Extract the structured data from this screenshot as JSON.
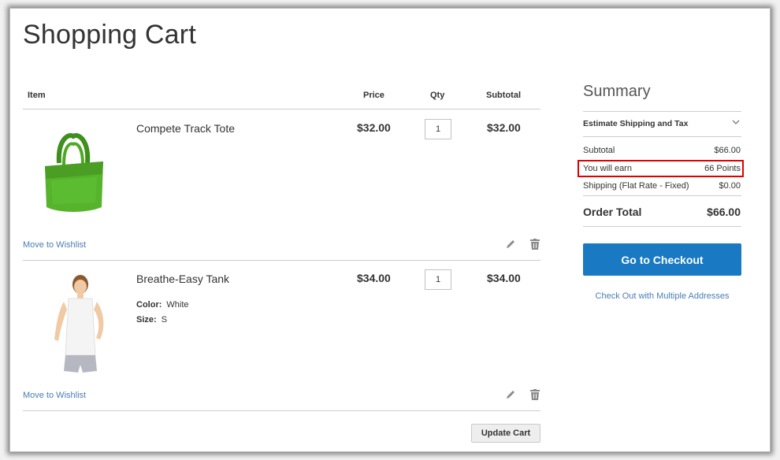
{
  "page": {
    "title": "Shopping Cart"
  },
  "cart": {
    "headers": {
      "item": "Item",
      "price": "Price",
      "qty": "Qty",
      "subtotal": "Subtotal"
    },
    "items": [
      {
        "name": "Compete Track Tote",
        "price": "$32.00",
        "qty": "1",
        "subtotal": "$32.00",
        "image_icon": "green-tote-bag-icon",
        "move_to_wishlist": "Move to Wishlist"
      },
      {
        "name": "Breathe-Easy Tank",
        "price": "$34.00",
        "qty": "1",
        "subtotal": "$34.00",
        "image_icon": "woman-tank-top-photo",
        "options": [
          {
            "label": "Color:",
            "value": "White"
          },
          {
            "label": "Size:",
            "value": "S"
          }
        ],
        "move_to_wishlist": "Move to Wishlist"
      }
    ],
    "update_button": "Update Cart"
  },
  "summary": {
    "title": "Summary",
    "estimate_label": "Estimate Shipping and Tax",
    "subtotal": {
      "label": "Subtotal",
      "value": "$66.00"
    },
    "earn": {
      "label": "You will earn",
      "value": "66 Points"
    },
    "shipping": {
      "label": "Shipping (Flat Rate - Fixed)",
      "value": "$0.00"
    },
    "order_total": {
      "label": "Order Total",
      "value": "$66.00"
    },
    "checkout_button": "Go to Checkout",
    "multi_address_link": "Check Out with Multiple Addresses"
  },
  "colors": {
    "accent": "#1979c3",
    "link": "#4a7eb5",
    "highlight": "#e00000",
    "tote_green": "#56b32c"
  }
}
